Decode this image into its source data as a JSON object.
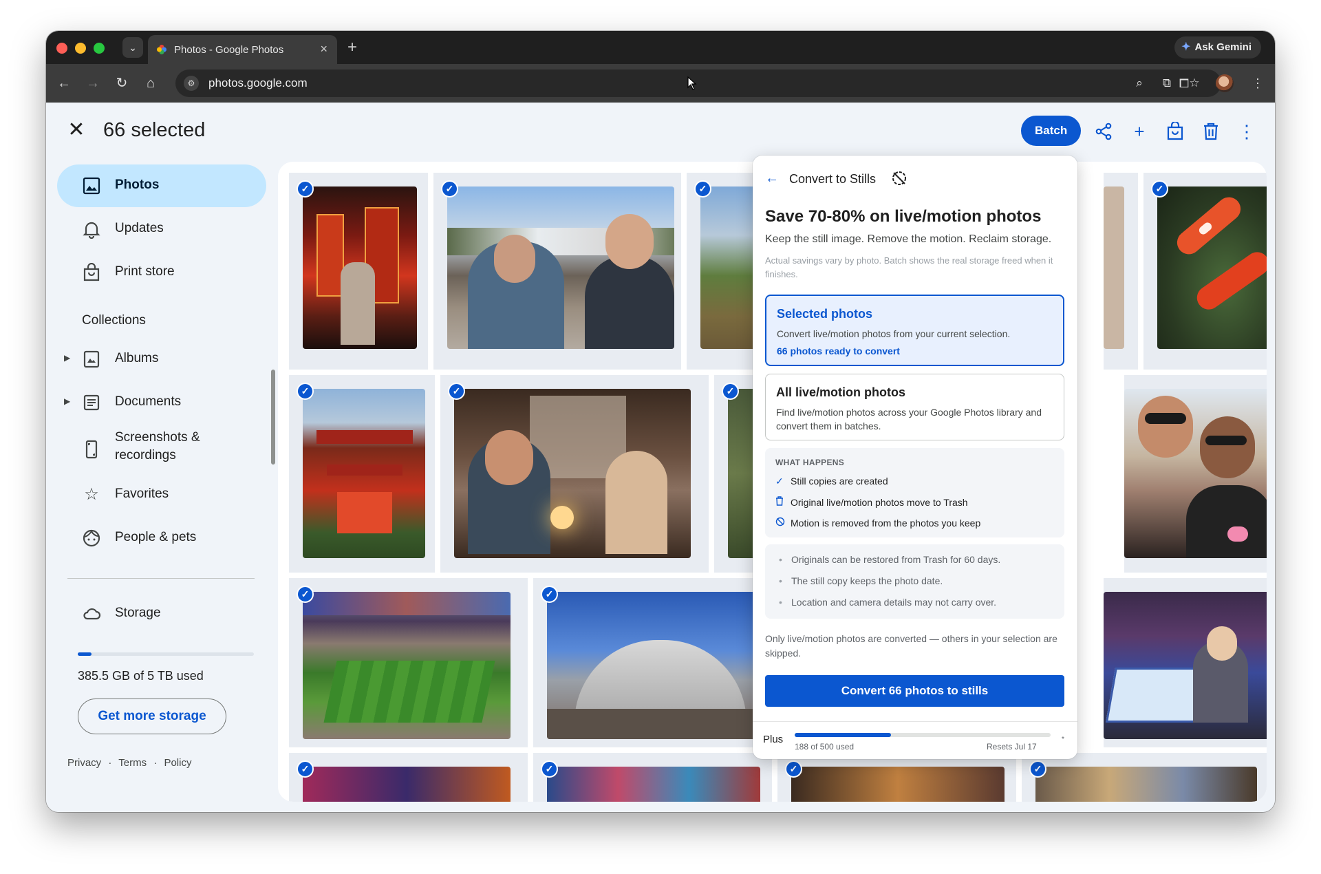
{
  "browser": {
    "tab_title": "Photos - Google Photos",
    "url": "photos.google.com",
    "gemini_label": "Ask Gemini"
  },
  "app": {
    "selected_count_label": "66 selected",
    "batch_label": "Batch"
  },
  "sidebar": {
    "items": [
      {
        "label": "Photos",
        "icon": "photo-icon",
        "active": true
      },
      {
        "label": "Updates",
        "icon": "bell-icon",
        "active": false
      },
      {
        "label": "Print store",
        "icon": "shopping-bag-icon",
        "active": false
      }
    ],
    "collections_label": "Collections",
    "collections": [
      {
        "label": "Albums",
        "icon": "album-icon",
        "expandable": true
      },
      {
        "label": "Documents",
        "icon": "document-icon",
        "expandable": true
      },
      {
        "label": "Screenshots &",
        "label2": "recordings",
        "icon": "screenshot-icon",
        "expandable": false
      },
      {
        "label": "Favorites",
        "icon": "star-icon",
        "expandable": false
      },
      {
        "label": "People & pets",
        "icon": "face-icon",
        "expandable": false
      }
    ],
    "storage": {
      "label": "Storage",
      "used_text": "385.5 GB of 5 TB used",
      "used_fraction": 0.077,
      "button_label": "Get more storage"
    },
    "footer": {
      "privacy": "Privacy",
      "sep": "·",
      "terms": "Terms",
      "policy": "Policy"
    }
  },
  "panel": {
    "title": "Convert to Stills",
    "headline": "Save 70-80% on live/motion photos",
    "subtitle": "Keep the still image. Remove the motion. Reclaim storage.",
    "note": "Actual savings vary by photo. Batch shows the real storage freed when it finishes.",
    "option_selected": {
      "title": "Selected photos",
      "desc": "Convert live/motion photos from your current selection.",
      "ready": "66 photos ready to convert"
    },
    "option_all": {
      "title": "All live/motion photos",
      "desc": "Find live/motion photos across your Google Photos library and convert them in batches."
    },
    "what_happens": {
      "heading": "WHAT HAPPENS",
      "items": [
        {
          "icon": "check-icon",
          "text": "Still copies are created"
        },
        {
          "icon": "trash-icon",
          "text": "Original live/motion photos move to Trash"
        },
        {
          "icon": "motion-off-icon",
          "text": "Motion is removed from the photos you keep"
        }
      ]
    },
    "notes": [
      "Originals can be restored from Trash for 60 days.",
      "The still copy keeps the photo date.",
      "Location and camera details may not carry over."
    ],
    "only_live": "Only live/motion photos are converted — others in your selection are skipped.",
    "convert_button": "Convert 66 photos to stills",
    "plan": {
      "label": "Plus",
      "used_text": "188 of 500 used",
      "used_fraction": 0.376,
      "reset_text": "Resets Jul 17",
      "asterisk": "*"
    }
  },
  "photos": [
    {
      "desc": "arcade"
    },
    {
      "desc": "two men selfie"
    },
    {
      "desc": "mountain"
    },
    {
      "desc": "koi"
    },
    {
      "desc": "red pagoda"
    },
    {
      "desc": "restaurant selfie"
    },
    {
      "desc": "plant"
    },
    {
      "desc": "couple party"
    },
    {
      "desc": "stadium"
    },
    {
      "desc": "stadium exterior"
    },
    {
      "desc": "air hockey"
    }
  ]
}
